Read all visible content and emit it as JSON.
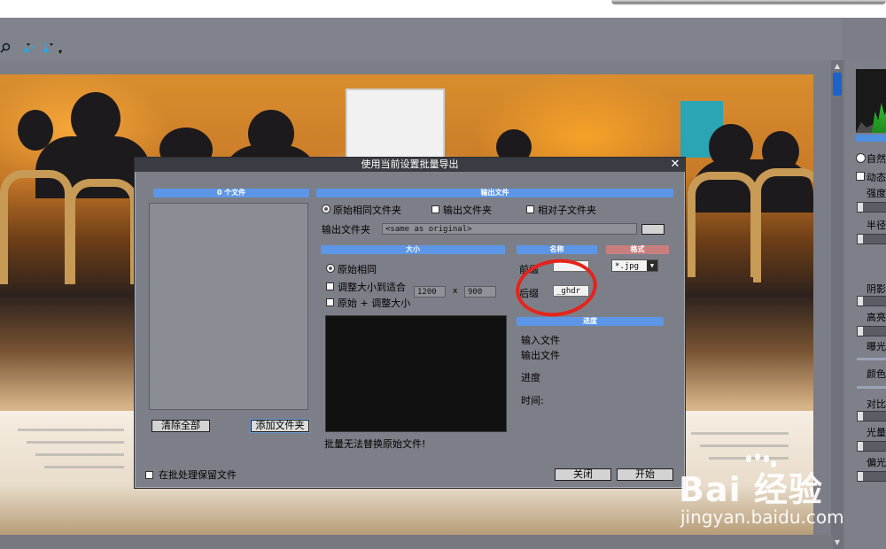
{
  "toolbar": {
    "icons": [
      "zoom-icon",
      "fit-icon",
      "fit-alt-icon"
    ],
    "more_glyph": "▾"
  },
  "right_panel": {
    "options": [
      {
        "label": "自然",
        "type": "radio",
        "checked": true
      },
      {
        "label": "动态",
        "type": "checkbox",
        "checked": false
      }
    ],
    "sliders": [
      "强度",
      "半径",
      "阴影",
      "高亮",
      "曝光",
      "颜色",
      "对比",
      "光量",
      "偏光"
    ]
  },
  "dialog": {
    "title": "使用当前设置批量导出",
    "close_glyph": "✕",
    "file_list": {
      "header": "0 个文件",
      "clear_button": "清除全部",
      "add_folder_button": "添加文件夹"
    },
    "output": {
      "header": "输出文件",
      "options": [
        "原始相同文件夹",
        "输出文件夹",
        "相对子文件夹"
      ],
      "selected": "原始相同文件夹",
      "folder_label": "输出文件夹",
      "folder_value": "<same as original>"
    },
    "size": {
      "header": "大小",
      "options": [
        "原始相同",
        "调整大小到适合",
        "原始 + 调整大小"
      ],
      "selected": "原始相同",
      "width": "1200",
      "x_label": "x",
      "height": "900"
    },
    "naming": {
      "header": "名称",
      "prefix_label": "前缀",
      "prefix_value": "",
      "suffix_label": "后缀",
      "suffix_value": "_ghdr"
    },
    "format": {
      "header": "格式",
      "value": "*.jpg"
    },
    "progress": {
      "header": "进度",
      "input_file": "输入文件",
      "output_file": "输出文件",
      "progress": "进度",
      "time": "时间:"
    },
    "warning": "批量无法替换原始文件!",
    "keep_files_label": "在批处理保留文件",
    "keep_files_checked": false,
    "close_button": "关闭",
    "start_button": "开始"
  },
  "watermark": {
    "logo": "Bai 经验",
    "url": "jingyan.baidu.com"
  },
  "colors": {
    "header_blue": "#5d96e6",
    "header_red": "#c97e7e",
    "annotation_red": "#e5231c",
    "app_gray": "#7b7e86"
  }
}
